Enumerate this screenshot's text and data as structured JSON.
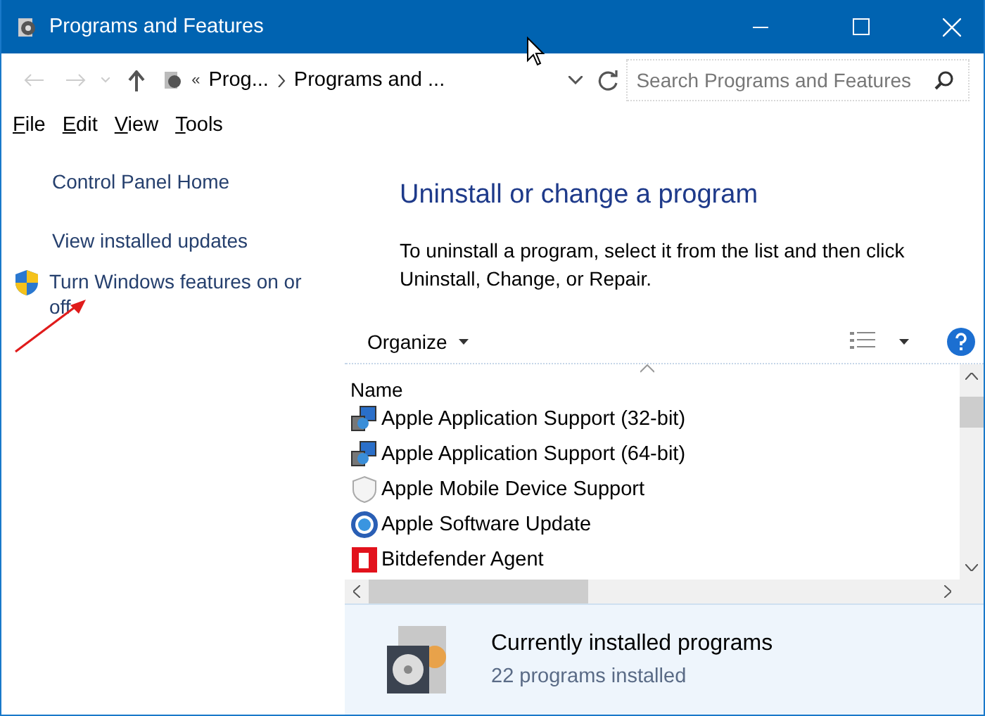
{
  "window": {
    "title": "Programs and Features"
  },
  "address_bar": {
    "crumb_overflow": "«",
    "path": [
      "Prog...",
      "Programs and ..."
    ]
  },
  "search": {
    "placeholder": "Search Programs and Features"
  },
  "menu": [
    "File",
    "Edit",
    "View",
    "Tools"
  ],
  "sidebar": {
    "links": [
      "Control Panel Home",
      "View installed updates"
    ],
    "feature_link": "Turn Windows features on or off"
  },
  "main": {
    "heading": "Uninstall or change a program",
    "description": "To uninstall a program, select it from the list and then click Uninstall, Change, or Repair."
  },
  "toolbar": {
    "organize": "Organize"
  },
  "table": {
    "columns": [
      "Name"
    ],
    "rows": [
      {
        "name": "Apple Application Support (32-bit)",
        "kind": "installer"
      },
      {
        "name": "Apple Application Support (64-bit)",
        "kind": "installer"
      },
      {
        "name": "Apple Mobile Device Support",
        "kind": "shield"
      },
      {
        "name": "Apple Software Update",
        "kind": "update"
      },
      {
        "name": "Bitdefender Agent",
        "kind": "brand"
      }
    ]
  },
  "details": {
    "title": "Currently installed programs",
    "count": "22 programs installed"
  }
}
